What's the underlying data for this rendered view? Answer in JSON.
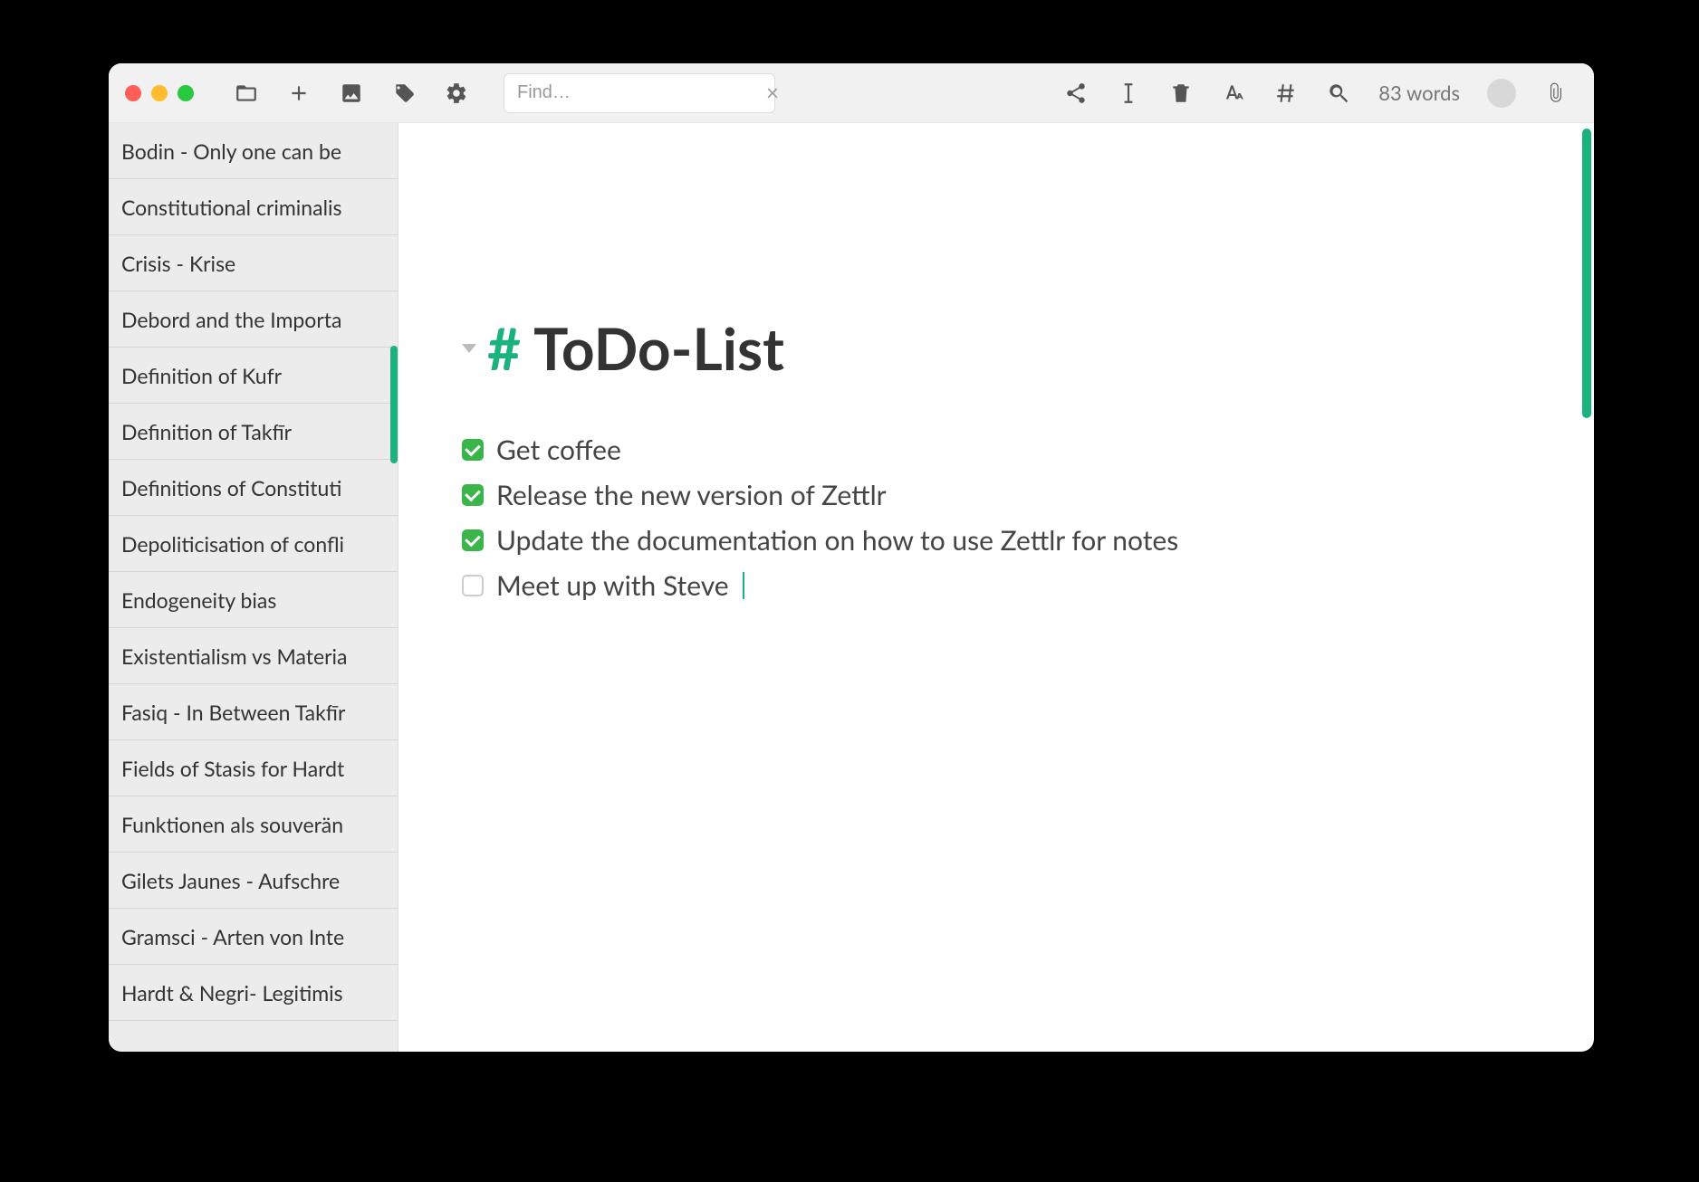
{
  "toolbar": {
    "find_placeholder": "Find…",
    "wordcount": "83 words"
  },
  "sidebar": {
    "items": [
      "Bodin - Only one can be",
      "Constitutional criminalis",
      "Crisis - Krise",
      "Debord and the Importa",
      "Definition of Kufr",
      "Definition of Takfīr",
      "Definitions of Constituti",
      "Depoliticisation of confli",
      "Endogeneity bias",
      "Existentialism vs Materia",
      "Fasiq - In Between Takfīr",
      "Fields of Stasis for Hardt",
      "Funktionen als souverän",
      "Gilets Jaunes - Aufschre",
      "Gramsci - Arten von Inte",
      "Hardt & Negri- Legitimis"
    ]
  },
  "document": {
    "hash": "#",
    "title": "ToDo-List",
    "tasks": [
      {
        "checked": true,
        "text": "Get coffee"
      },
      {
        "checked": true,
        "text": "Release the new version of Zettlr"
      },
      {
        "checked": true,
        "text": "Update the documentation on how to use Zettlr for notes"
      },
      {
        "checked": false,
        "text": "Meet up with Steve"
      }
    ]
  }
}
